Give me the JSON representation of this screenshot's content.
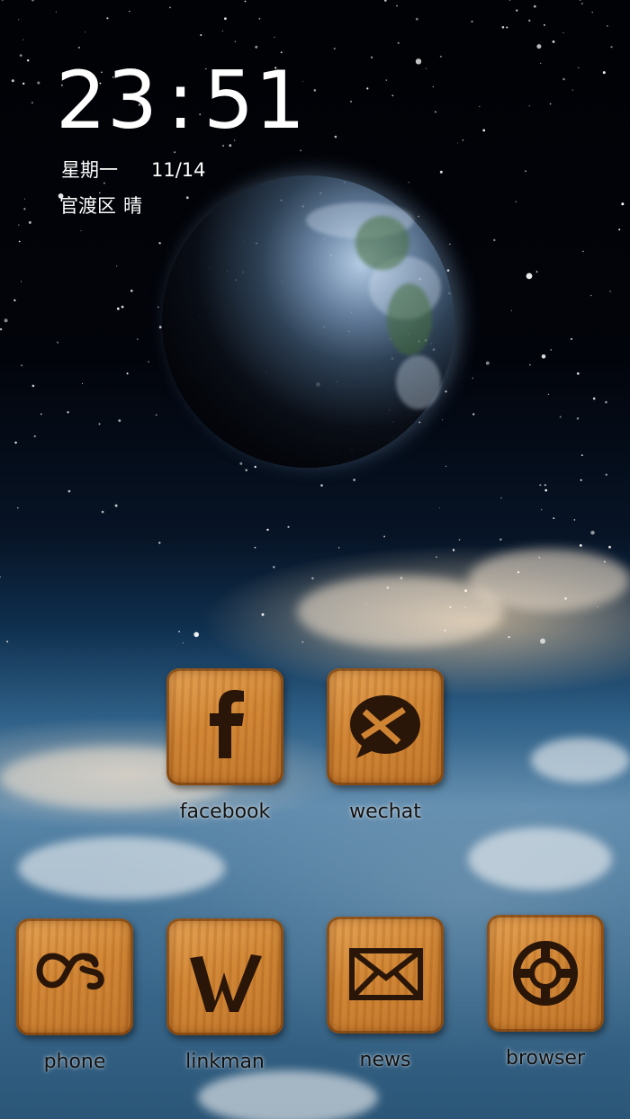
{
  "lockscreen": {
    "time": "23 : 51",
    "weekday": "星期一",
    "date": "11/14",
    "location": "官渡区",
    "weather": "晴"
  },
  "apps": [
    {
      "label": "facebook",
      "icon": "facebook-icon"
    },
    {
      "label": "wechat",
      "icon": "chat-bubble-icon"
    },
    {
      "label": "phone",
      "icon": "lastfm-icon"
    },
    {
      "label": "linkman",
      "icon": "w-logo-icon"
    },
    {
      "label": "news",
      "icon": "envelope-icon"
    },
    {
      "label": "browser",
      "icon": "lifebuoy-icon"
    }
  ],
  "colors": {
    "tile_wood": "#cf8433",
    "icon_ink": "#2a1608",
    "label_text": "#111111",
    "clock_text": "#ffffff"
  }
}
